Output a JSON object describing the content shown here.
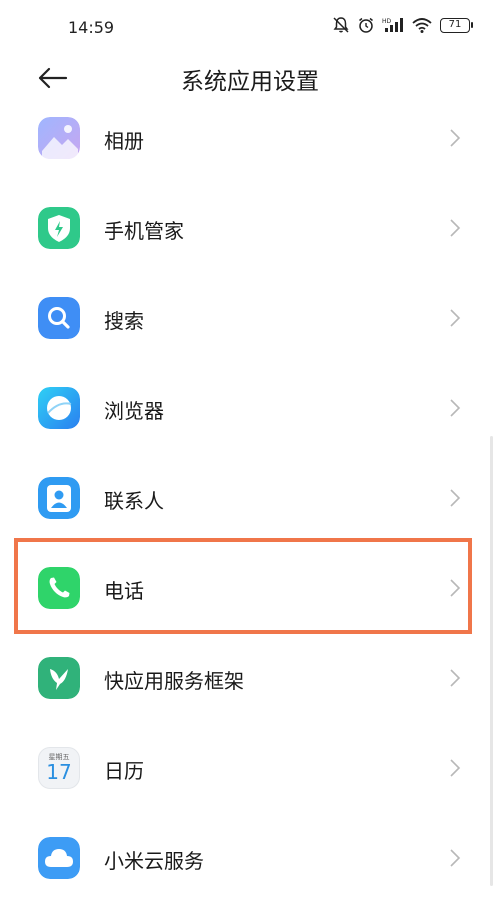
{
  "status_bar": {
    "time": "14:59",
    "battery": "71",
    "icons": [
      "mute-icon",
      "alarm-icon",
      "signal-icon",
      "wifi-icon",
      "battery-icon"
    ]
  },
  "header": {
    "title": "系统应用设置",
    "back_icon": "back-arrow-icon"
  },
  "apps": [
    {
      "label": "相册",
      "icon": "gallery-icon",
      "color": "#7a8ff0"
    },
    {
      "label": "手机管家",
      "icon": "security-shield-icon",
      "color": "#2fc98a"
    },
    {
      "label": "搜索",
      "icon": "search-icon",
      "color": "#3f8ef5"
    },
    {
      "label": "浏览器",
      "icon": "browser-icon",
      "color": "#2aa6f5"
    },
    {
      "label": "联系人",
      "icon": "contacts-icon",
      "color": "#2f9bf2"
    },
    {
      "label": "电话",
      "icon": "phone-icon",
      "color": "#2fd46a"
    },
    {
      "label": "快应用服务框架",
      "icon": "quickapp-icon",
      "color": "#30b27a"
    },
    {
      "label": "日历",
      "icon": "calendar-icon",
      "color": "#2a8fe0",
      "weekday": "星期五",
      "date": "17"
    },
    {
      "label": "小米云服务",
      "icon": "cloud-icon",
      "color": "#3d9cf5"
    }
  ],
  "highlight_color": "#f0764a"
}
